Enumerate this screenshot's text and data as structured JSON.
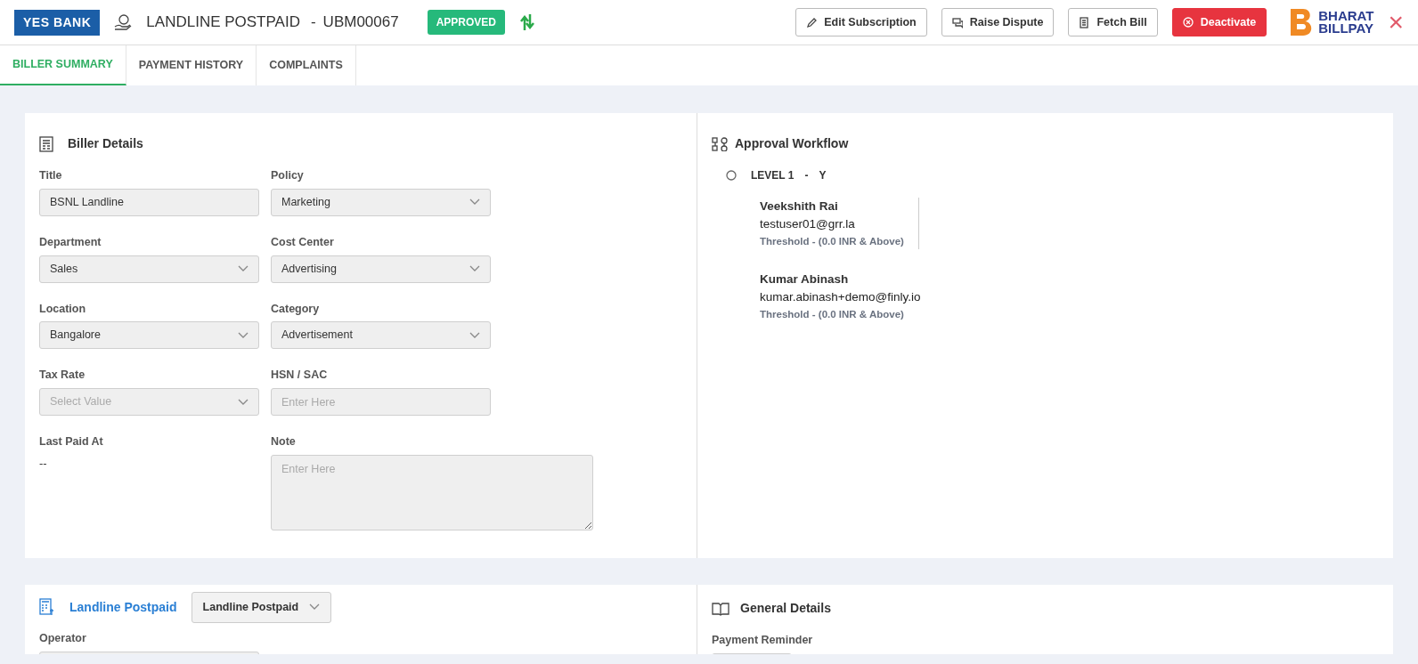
{
  "header": {
    "bank_logo": "YES BANK",
    "title": "LANDLINE POSTPAID",
    "separator": "-",
    "code": "UBM00067",
    "status": "APPROVED",
    "actions": [
      {
        "label": "Edit Subscription",
        "kind": "outline"
      },
      {
        "label": "Raise Dispute",
        "kind": "outline"
      },
      {
        "label": "Fetch Bill",
        "kind": "outline"
      },
      {
        "label": "Deactivate",
        "kind": "danger"
      }
    ],
    "bbps_logo": [
      "BHARAT",
      "BILLPAY"
    ],
    "close": "×"
  },
  "tabs": [
    {
      "label": "BILLER SUMMARY",
      "selected": true
    },
    {
      "label": "PAYMENT HISTORY",
      "selected": false
    },
    {
      "label": "COMPLAINTS",
      "selected": false
    }
  ],
  "biller_details": {
    "title": "Biller Details",
    "fields": [
      {
        "label": "Title",
        "kind": "input",
        "value": "BSNL Landline"
      },
      {
        "label": "Policy",
        "kind": "select",
        "value": "Marketing"
      },
      {
        "label": "Department",
        "kind": "select",
        "value": "Sales"
      },
      {
        "label": "Cost Center",
        "kind": "select",
        "value": "Advertising"
      },
      {
        "label": "Location",
        "kind": "select",
        "value": "Bangalore"
      },
      {
        "label": "Category",
        "kind": "select",
        "value": "Advertisement"
      },
      {
        "label": "Tax Rate",
        "kind": "select",
        "placeholder": "Select Value"
      },
      {
        "label": "HSN / SAC",
        "kind": "input",
        "placeholder": "Enter Here"
      },
      {
        "label": "Last Paid At",
        "kind": "text",
        "value": "--"
      },
      {
        "label": "Note",
        "kind": "textarea",
        "placeholder": "Enter Here"
      }
    ]
  },
  "approval_workflow": {
    "title": "Approval Workflow",
    "levels": [
      {
        "label": "LEVEL 1",
        "separator": "-",
        "value": "Y",
        "done": false,
        "approvers": [
          {
            "name": "Veekshith Rai",
            "email": "testuser01@grr.la",
            "threshold": "Threshold -  (0.0 INR   & Above)"
          },
          {
            "name": "Kumar Abinash",
            "email": "kumar.abinash+demo@finly.io",
            "threshold": "Threshold -  (0.0 INR   & Above)"
          }
        ]
      }
    ]
  },
  "landline_section": {
    "title": "Landline Postpaid",
    "select_value": "Landline Postpaid",
    "fields": [
      {
        "label": "Operator"
      }
    ]
  },
  "general_details": {
    "title": "General Details",
    "fields": [
      {
        "label": "Payment Reminder"
      }
    ]
  }
}
